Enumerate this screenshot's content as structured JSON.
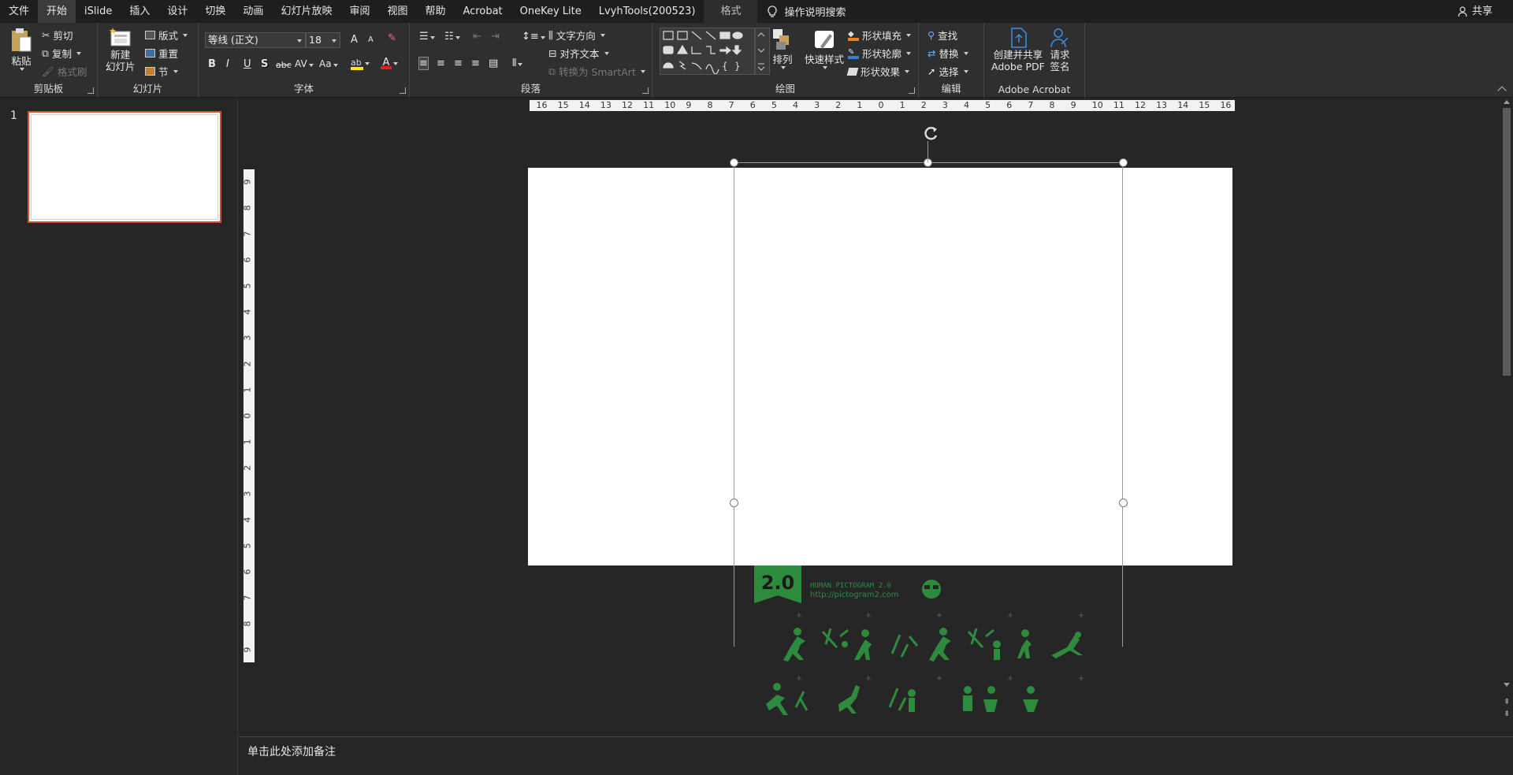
{
  "menubar": {
    "items": [
      "文件",
      "开始",
      "iSlide",
      "插入",
      "设计",
      "切换",
      "动画",
      "幻灯片放映",
      "审阅",
      "视图",
      "帮助",
      "Acrobat",
      "OneKey Lite",
      "LvyhTools(200523)",
      "格式"
    ],
    "active": "开始",
    "tell_me": "操作说明搜索",
    "share": "共享"
  },
  "ribbon": {
    "clipboard": {
      "label": "剪贴板",
      "paste": "粘贴",
      "cut": "剪切",
      "copy": "复制",
      "format_painter": "格式刷"
    },
    "slides": {
      "label": "幻灯片",
      "new_slide_1": "新建",
      "new_slide_2": "幻灯片",
      "layout": "版式",
      "reset": "重置",
      "section": "节"
    },
    "font": {
      "label": "字体",
      "font_name": "等线 (正文)",
      "font_size": "18",
      "bold": "B",
      "italic": "I",
      "underline": "U",
      "shadow": "S",
      "strike": "abc",
      "spacing": "AV",
      "case": "Aa",
      "grow": "A",
      "shrink": "A"
    },
    "paragraph": {
      "label": "段落",
      "text_direction": "文字方向",
      "align_text": "对齐文本",
      "convert_smartart": "转换为 SmartArt"
    },
    "drawing": {
      "label": "绘图",
      "arrange": "排列",
      "quick_styles": "快速样式",
      "shape_fill": "形状填充",
      "shape_outline": "形状轮廓",
      "shape_effects": "形状效果"
    },
    "editing": {
      "label": "编辑",
      "find": "查找",
      "replace": "替换",
      "select": "选择"
    },
    "acrobat": {
      "label": "Adobe Acrobat",
      "create_share_1": "创建并共享",
      "create_share_2": "Adobe PDF",
      "request_sign_1": "请求",
      "request_sign_2": "签名"
    }
  },
  "thumbnails": {
    "slide_number": "1"
  },
  "rulers": {
    "horizontal": [
      "16",
      "15",
      "14",
      "13",
      "12",
      "11",
      "10",
      "9",
      "8",
      "7",
      "6",
      "5",
      "4",
      "3",
      "2",
      "1",
      "0",
      "1",
      "2",
      "3",
      "4",
      "5",
      "6",
      "7",
      "8",
      "9",
      "10",
      "11",
      "12",
      "13",
      "14",
      "15",
      "16"
    ],
    "vertical": [
      "9",
      "8",
      "7",
      "6",
      "5",
      "4",
      "3",
      "2",
      "1",
      "0",
      "1",
      "2",
      "3",
      "4",
      "5",
      "6",
      "7",
      "8",
      "9"
    ]
  },
  "pictogram": {
    "badge": "2.0",
    "title": "HUMAN PICTOGRAM 2.0",
    "url": "http://pictogram2.com"
  },
  "notes": {
    "placeholder": "单击此处添加备注"
  },
  "colors": {
    "accent": "#d35230",
    "pictogram_green": "#2e8b3d",
    "background": "#262626"
  }
}
